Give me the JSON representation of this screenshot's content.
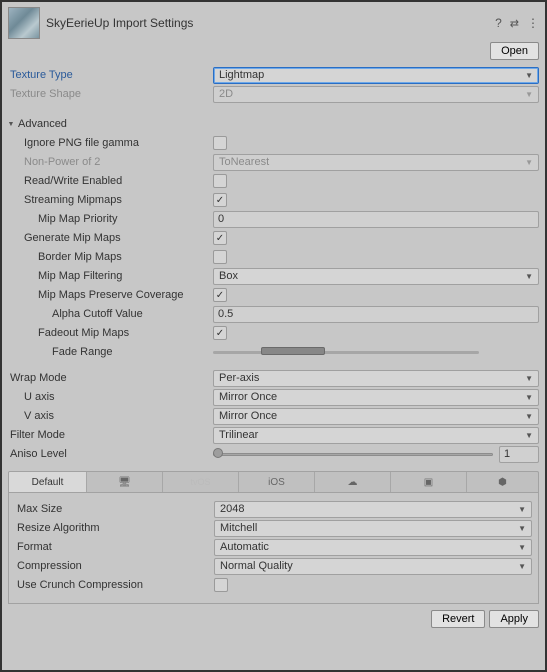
{
  "header": {
    "title": "SkyEerieUp Import Settings",
    "open_label": "Open"
  },
  "texture": {
    "type_label": "Texture Type",
    "type_value": "Lightmap",
    "shape_label": "Texture Shape",
    "shape_value": "2D"
  },
  "advanced": {
    "heading": "Advanced",
    "ignore_png_label": "Ignore PNG file gamma",
    "ignore_png": false,
    "npo2_label": "Non-Power of 2",
    "npo2_value": "ToNearest",
    "rw_label": "Read/Write Enabled",
    "rw": false,
    "streaming_label": "Streaming Mipmaps",
    "streaming": true,
    "mip_priority_label": "Mip Map Priority",
    "mip_priority": "0",
    "gen_mip_label": "Generate Mip Maps",
    "gen_mip": true,
    "border_mip_label": "Border Mip Maps",
    "border_mip": false,
    "mip_filter_label": "Mip Map Filtering",
    "mip_filter_value": "Box",
    "preserve_cov_label": "Mip Maps Preserve Coverage",
    "preserve_cov": true,
    "alpha_cutoff_label": "Alpha Cutoff Value",
    "alpha_cutoff": "0.5",
    "fadeout_label": "Fadeout Mip Maps",
    "fadeout": true,
    "fade_range_label": "Fade Range"
  },
  "wrap": {
    "mode_label": "Wrap Mode",
    "mode_value": "Per-axis",
    "u_label": "U axis",
    "u_value": "Mirror Once",
    "v_label": "V axis",
    "v_value": "Mirror Once"
  },
  "filter": {
    "mode_label": "Filter Mode",
    "mode_value": "Trilinear",
    "aniso_label": "Aniso Level",
    "aniso_value": "1"
  },
  "platform_tabs": {
    "default": "Default"
  },
  "platform": {
    "max_size_label": "Max Size",
    "max_size_value": "2048",
    "resize_label": "Resize Algorithm",
    "resize_value": "Mitchell",
    "format_label": "Format",
    "format_value": "Automatic",
    "compression_label": "Compression",
    "compression_value": "Normal Quality",
    "crunch_label": "Use Crunch Compression",
    "crunch": false
  },
  "footer": {
    "revert": "Revert",
    "apply": "Apply"
  }
}
